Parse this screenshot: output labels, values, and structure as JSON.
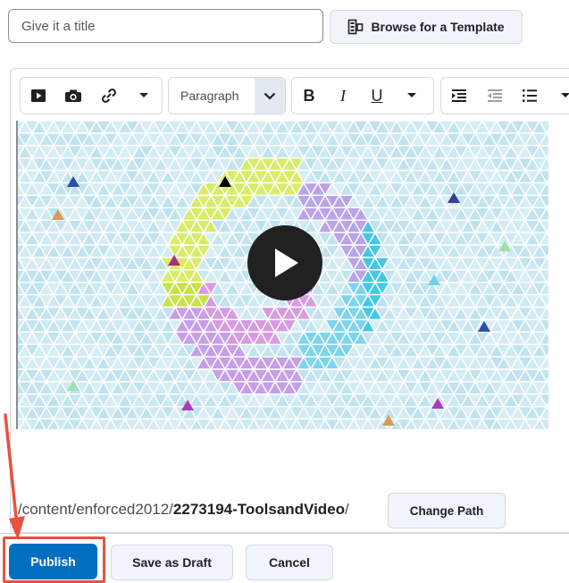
{
  "title_field": {
    "placeholder": "Give it a title",
    "value": ""
  },
  "template_button": {
    "label": "Browse for a Template",
    "icon": "template-icon"
  },
  "toolbar": {
    "insert_stuff_icon": "insert-stuff-icon",
    "insert_image_icon": "camera-icon",
    "insert_link_icon": "link-icon",
    "more_insert_icon": "chevron-down-icon",
    "format_select": "Paragraph",
    "bold": "B",
    "italic": "I",
    "underline": "U",
    "indent_icon": "indent-icon",
    "outdent_icon": "outdent-icon",
    "list_icon": "bullet-list-icon"
  },
  "video": {
    "play_icon": "play-icon"
  },
  "path": {
    "prefix": "/content/enforced2012/",
    "folder": "2273194-ToolsandVideo",
    "suffix": "/",
    "change_label": "Change Path"
  },
  "actions": {
    "publish": "Publish",
    "save_draft": "Save as Draft",
    "cancel": "Cancel"
  },
  "colors": {
    "primary": "#006fbf",
    "highlight": "#e8523f",
    "pattern_base": "#cfe9f2"
  }
}
